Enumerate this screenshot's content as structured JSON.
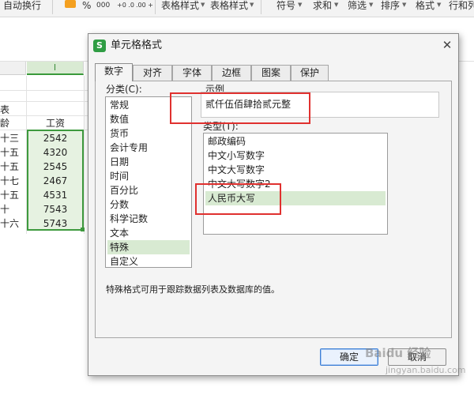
{
  "toolbar": {
    "items": [
      "自动换行",
      "%",
      "000",
      "+0 .00",
      ".00 +0",
      "表格样式",
      "表格样式",
      "符号",
      "求和",
      "筛选",
      "排序",
      "格式",
      "行和列"
    ]
  },
  "sheet": {
    "col_header_left": "",
    "col_header_i": "I",
    "title_partial": "表",
    "header_left": "龄",
    "header_value": "工资",
    "rows": [
      {
        "left": "十三",
        "value": "2542"
      },
      {
        "left": "十五",
        "value": "4320"
      },
      {
        "left": "十五",
        "value": "2545"
      },
      {
        "left": "十七",
        "value": "2467"
      },
      {
        "left": "十五",
        "value": "4531"
      },
      {
        "left": "十",
        "value": "7543"
      },
      {
        "left": "十六",
        "value": "5743"
      }
    ],
    "selection_color": "#3e9a3e"
  },
  "dialog": {
    "app_icon": "S",
    "title": "单元格格式",
    "close": "✕",
    "tabs": [
      {
        "label": "数字",
        "active": true
      },
      {
        "label": "对齐",
        "active": false
      },
      {
        "label": "字体",
        "active": false
      },
      {
        "label": "边框",
        "active": false
      },
      {
        "label": "图案",
        "active": false
      },
      {
        "label": "保护",
        "active": false
      }
    ],
    "category_label": "分类(C):",
    "categories": [
      {
        "label": "常规",
        "selected": false
      },
      {
        "label": "数值",
        "selected": false
      },
      {
        "label": "货币",
        "selected": false
      },
      {
        "label": "会计专用",
        "selected": false
      },
      {
        "label": "日期",
        "selected": false
      },
      {
        "label": "时间",
        "selected": false
      },
      {
        "label": "百分比",
        "selected": false
      },
      {
        "label": "分数",
        "selected": false
      },
      {
        "label": "科学记数",
        "selected": false
      },
      {
        "label": "文本",
        "selected": false
      },
      {
        "label": "特殊",
        "selected": true
      },
      {
        "label": "自定义",
        "selected": false
      }
    ],
    "sample_label": "示例",
    "sample_value": "贰仟伍佰肆拾贰元整",
    "type_label": "类型(T):",
    "types": [
      {
        "label": "邮政编码",
        "selected": false
      },
      {
        "label": "中文小写数字",
        "selected": false
      },
      {
        "label": "中文大写数字",
        "selected": false
      },
      {
        "label": "中文大写数字2",
        "selected": false
      },
      {
        "label": "人民币大写",
        "selected": true
      }
    ],
    "description": "特殊格式可用于跟踪数据列表及数据库的值。",
    "ok_label": "确定",
    "cancel_label": "取消",
    "highlight_color": "#e0312f"
  },
  "watermark": {
    "brand": "Baidu 经验",
    "site": "jingyan.baidu.com"
  }
}
